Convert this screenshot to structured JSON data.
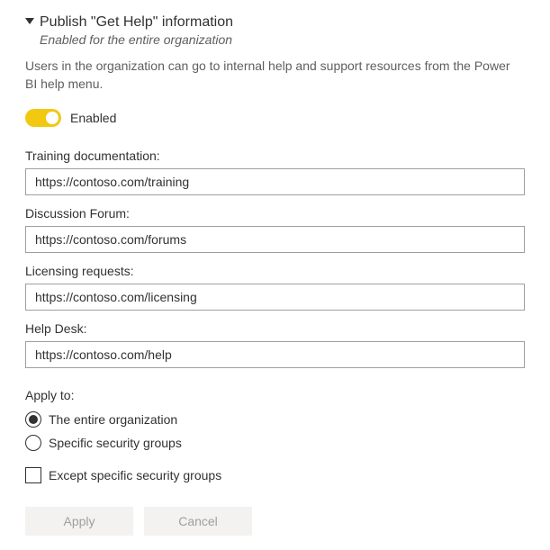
{
  "header": {
    "title": "Publish \"Get Help\" information",
    "subtitle": "Enabled for the entire organization",
    "description": "Users in the organization can go to internal help and support resources from the Power BI help menu."
  },
  "toggle": {
    "label": "Enabled"
  },
  "fields": {
    "training": {
      "label": "Training documentation:",
      "value": "https://contoso.com/training"
    },
    "forum": {
      "label": "Discussion Forum:",
      "value": "https://contoso.com/forums"
    },
    "licensing": {
      "label": "Licensing requests:",
      "value": "https://contoso.com/licensing"
    },
    "helpdesk": {
      "label": "Help Desk:",
      "value": "https://contoso.com/help"
    }
  },
  "apply": {
    "label": "Apply to:",
    "options": {
      "entire": "The entire organization",
      "specific": "Specific security groups"
    },
    "except": "Except specific security groups"
  },
  "buttons": {
    "apply": "Apply",
    "cancel": "Cancel"
  }
}
